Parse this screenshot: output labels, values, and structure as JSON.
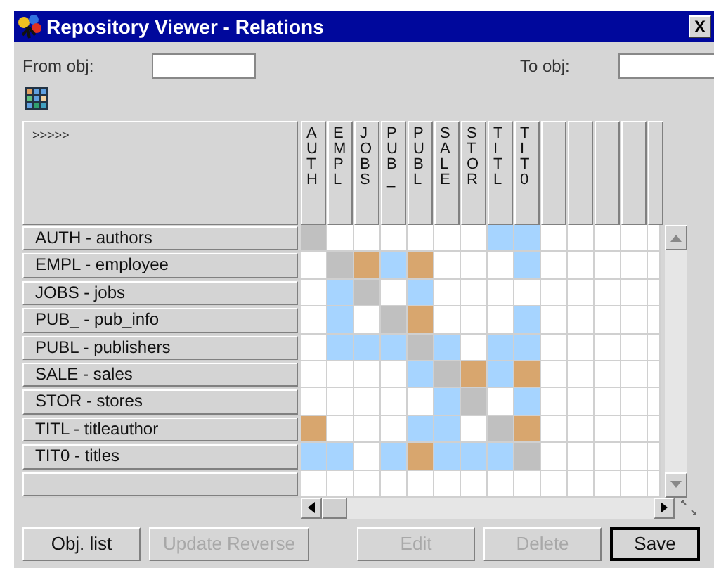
{
  "window": {
    "title": "Repository Viewer - Relations",
    "close": "X"
  },
  "from_field": {
    "label": "From obj:"
  },
  "to_field": {
    "label": "To obj:"
  },
  "matrix": {
    "corner": ">>>>>",
    "columns": [
      "AUTH",
      "EMPL",
      "JOBS",
      "PUB_",
      "PUBL",
      "SALE",
      "STOR",
      "TITL",
      "TIT0"
    ],
    "rows": [
      {
        "label": "AUTH - authors",
        "cells": [
          {
            "color": "#c0c0c0"
          },
          {
            "color": "#ffffff"
          },
          {
            "color": "#ffffff"
          },
          {
            "color": "#ffffff"
          },
          {
            "color": "#ffffff"
          },
          {
            "color": "#ffffff"
          },
          {
            "color": "#ffffff"
          },
          {
            "color": "#a6d4ff"
          },
          {
            "color": "#a6d4ff"
          },
          {
            "color": "#ffffff"
          },
          {
            "color": "#ffffff"
          },
          {
            "color": "#ffffff"
          },
          {
            "color": "#ffffff"
          },
          {
            "color": "#ffffff"
          }
        ]
      },
      {
        "label": "EMPL - employee",
        "cells": [
          {
            "color": "#ffffff"
          },
          {
            "color": "#c0c0c0"
          },
          {
            "color": "#d8a66e"
          },
          {
            "color": "#a6d4ff"
          },
          {
            "color": "#d8a66e"
          },
          {
            "color": "#ffffff"
          },
          {
            "color": "#ffffff"
          },
          {
            "color": "#ffffff"
          },
          {
            "color": "#a6d4ff"
          },
          {
            "color": "#ffffff"
          },
          {
            "color": "#ffffff"
          },
          {
            "color": "#ffffff"
          },
          {
            "color": "#ffffff"
          },
          {
            "color": "#ffffff"
          }
        ]
      },
      {
        "label": "JOBS - jobs",
        "cells": [
          {
            "color": "#ffffff"
          },
          {
            "color": "#a6d4ff"
          },
          {
            "color": "#c0c0c0"
          },
          {
            "color": "#ffffff"
          },
          {
            "color": "#a6d4ff"
          },
          {
            "color": "#ffffff"
          },
          {
            "color": "#ffffff"
          },
          {
            "color": "#ffffff"
          },
          {
            "color": "#ffffff"
          },
          {
            "color": "#ffffff"
          },
          {
            "color": "#ffffff"
          },
          {
            "color": "#ffffff"
          },
          {
            "color": "#ffffff"
          },
          {
            "color": "#ffffff"
          }
        ]
      },
      {
        "label": "PUB_ - pub_info",
        "cells": [
          {
            "color": "#ffffff"
          },
          {
            "color": "#a6d4ff"
          },
          {
            "color": "#ffffff"
          },
          {
            "color": "#c0c0c0"
          },
          {
            "color": "#d8a66e"
          },
          {
            "color": "#ffffff"
          },
          {
            "color": "#ffffff"
          },
          {
            "color": "#ffffff"
          },
          {
            "color": "#a6d4ff"
          },
          {
            "color": "#ffffff"
          },
          {
            "color": "#ffffff"
          },
          {
            "color": "#ffffff"
          },
          {
            "color": "#ffffff"
          },
          {
            "color": "#ffffff"
          }
        ]
      },
      {
        "label": "PUBL - publishers",
        "cells": [
          {
            "color": "#ffffff"
          },
          {
            "color": "#a6d4ff"
          },
          {
            "color": "#a6d4ff"
          },
          {
            "color": "#a6d4ff"
          },
          {
            "color": "#c0c0c0"
          },
          {
            "color": "#a6d4ff"
          },
          {
            "color": "#ffffff"
          },
          {
            "color": "#a6d4ff"
          },
          {
            "color": "#a6d4ff"
          },
          {
            "color": "#ffffff"
          },
          {
            "color": "#ffffff"
          },
          {
            "color": "#ffffff"
          },
          {
            "color": "#ffffff"
          },
          {
            "color": "#ffffff"
          }
        ]
      },
      {
        "label": "SALE - sales",
        "cells": [
          {
            "color": "#ffffff"
          },
          {
            "color": "#ffffff"
          },
          {
            "color": "#ffffff"
          },
          {
            "color": "#ffffff"
          },
          {
            "color": "#a6d4ff"
          },
          {
            "color": "#c0c0c0"
          },
          {
            "color": "#d8a66e"
          },
          {
            "color": "#a6d4ff"
          },
          {
            "color": "#d8a66e"
          },
          {
            "color": "#ffffff"
          },
          {
            "color": "#ffffff"
          },
          {
            "color": "#ffffff"
          },
          {
            "color": "#ffffff"
          },
          {
            "color": "#ffffff"
          }
        ]
      },
      {
        "label": "STOR - stores",
        "cells": [
          {
            "color": "#ffffff"
          },
          {
            "color": "#ffffff"
          },
          {
            "color": "#ffffff"
          },
          {
            "color": "#ffffff"
          },
          {
            "color": "#ffffff"
          },
          {
            "color": "#a6d4ff"
          },
          {
            "color": "#c0c0c0"
          },
          {
            "color": "#ffffff"
          },
          {
            "color": "#a6d4ff"
          },
          {
            "color": "#ffffff"
          },
          {
            "color": "#ffffff"
          },
          {
            "color": "#ffffff"
          },
          {
            "color": "#ffffff"
          },
          {
            "color": "#ffffff"
          }
        ]
      },
      {
        "label": "TITL - titleauthor",
        "cells": [
          {
            "color": "#d8a66e"
          },
          {
            "color": "#ffffff"
          },
          {
            "color": "#ffffff"
          },
          {
            "color": "#ffffff"
          },
          {
            "color": "#a6d4ff"
          },
          {
            "color": "#a6d4ff"
          },
          {
            "color": "#ffffff"
          },
          {
            "color": "#c0c0c0"
          },
          {
            "color": "#d8a66e"
          },
          {
            "color": "#ffffff"
          },
          {
            "color": "#ffffff"
          },
          {
            "color": "#ffffff"
          },
          {
            "color": "#ffffff"
          },
          {
            "color": "#ffffff"
          }
        ]
      },
      {
        "label": "TIT0 - titles",
        "cells": [
          {
            "color": "#a6d4ff"
          },
          {
            "color": "#a6d4ff"
          },
          {
            "color": "#ffffff"
          },
          {
            "color": "#a6d4ff"
          },
          {
            "color": "#d8a66e"
          },
          {
            "color": "#a6d4ff"
          },
          {
            "color": "#a6d4ff"
          },
          {
            "color": "#a6d4ff"
          },
          {
            "color": "#c0c0c0"
          },
          {
            "color": "#ffffff"
          },
          {
            "color": "#ffffff"
          },
          {
            "color": "#ffffff"
          },
          {
            "color": "#ffffff"
          },
          {
            "color": "#ffffff"
          }
        ]
      },
      {
        "cells": [
          {
            "color": "#ffffff"
          },
          {
            "color": "#ffffff"
          },
          {
            "color": "#ffffff"
          },
          {
            "color": "#ffffff"
          },
          {
            "color": "#ffffff"
          },
          {
            "color": "#ffffff"
          },
          {
            "color": "#ffffff"
          },
          {
            "color": "#ffffff"
          },
          {
            "color": "#ffffff"
          },
          {
            "color": "#ffffff"
          },
          {
            "color": "#ffffff"
          },
          {
            "color": "#ffffff"
          },
          {
            "color": "#ffffff"
          },
          {
            "color": "#ffffff"
          }
        ]
      }
    ]
  },
  "buttons": [
    {
      "label": "Obj. list",
      "disabled": false,
      "default": false
    },
    {
      "label": "Update Reverse",
      "disabled": true,
      "default": false
    },
    {
      "label": "Edit",
      "disabled": true,
      "default": false
    },
    {
      "label": "Delete",
      "disabled": true,
      "default": false
    },
    {
      "label": "Save",
      "disabled": false,
      "default": true
    }
  ]
}
